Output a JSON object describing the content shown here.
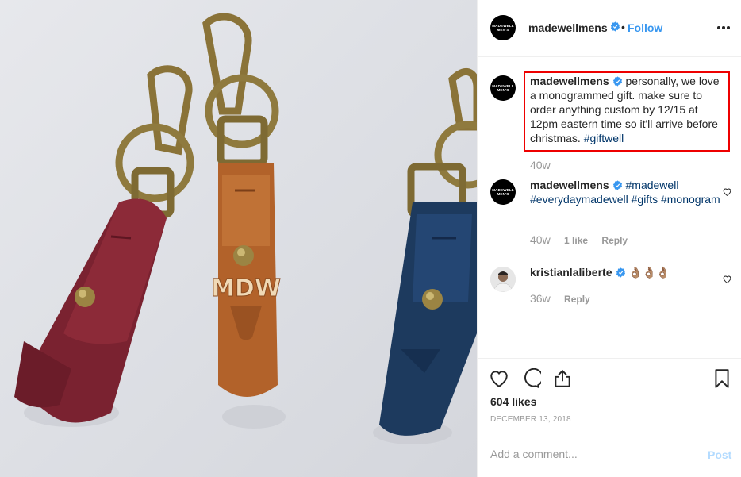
{
  "photo": {
    "stamp": "MDW"
  },
  "header": {
    "avatar_text": [
      "MADEWELL",
      "MEN'S"
    ],
    "username": "madewellmens",
    "dot": "•",
    "follow_label": "Follow",
    "icons": [
      "verified-badge-icon",
      "more-options-icon"
    ]
  },
  "comments": [
    {
      "username": "madewellmens",
      "text": "personally, we love a monogrammed gift. make sure to order anything custom by 12/15 at 12pm eastern time so it'll arrive before christmas.",
      "tag": "#giftwell",
      "age": "40w"
    },
    {
      "username": "madewellmens",
      "tags": [
        "#madewell",
        "#everydaymadewell",
        "#gifts",
        "#monogram"
      ],
      "age": "40w",
      "likes": "1 like",
      "reply": "Reply"
    },
    {
      "username": "kristianlaliberte",
      "text": "👌🏽👌🏽👌🏽",
      "age": "36w",
      "reply": "Reply"
    }
  ],
  "actions": {
    "icons": [
      "heart-icon",
      "comment-icon",
      "share-icon",
      "bookmark-icon"
    ],
    "likes": "604 likes",
    "date": "DECEMBER 13, 2018"
  },
  "add_comment": {
    "placeholder": "Add a comment...",
    "post_label": "Post"
  },
  "colors": {
    "link": "#3897f0",
    "hashtag": "#003569",
    "highlight": "#e00000",
    "muted": "#999999"
  }
}
